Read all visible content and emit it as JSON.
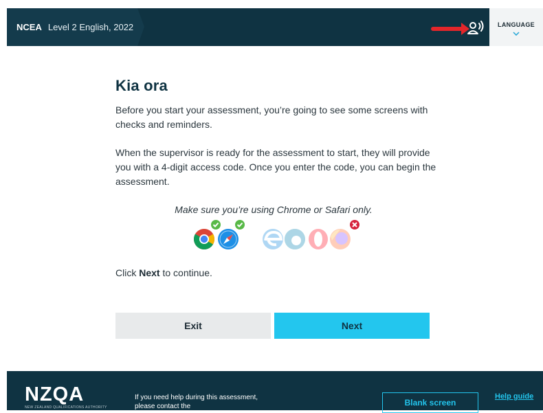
{
  "header": {
    "brand": "NCEA",
    "subject": "Level 2 English, 2022",
    "language_label": "LANGUAGE"
  },
  "main": {
    "title": "Kia ora",
    "paragraph1": "Before you start your assessment, you’re going to see some screens with checks and reminders.",
    "paragraph2": "When the supervisor is ready for the assessment to start, they will provide you with a 4-digit access code. Once you enter the code, you can begin the assessment.",
    "browser_note": "Make sure you’re using Chrome or Safari only.",
    "click_prefix": "Click ",
    "click_bold": "Next",
    "click_suffix": " to continue."
  },
  "buttons": {
    "exit": "Exit",
    "next": "Next"
  },
  "footer": {
    "logo": "NZQA",
    "logo_sub": "NEW ZEALAND QUALIFICATIONS AUTHORITY",
    "help_text": "If you need help during this assessment, please contact the",
    "blank_screen": "Blank screen",
    "help_guide": "Help guide"
  },
  "icons": {
    "audio": "audio-person-icon",
    "language_chevron": "chevron-down-icon",
    "allowed_browsers": [
      "chrome-icon",
      "safari-icon"
    ],
    "disallowed_browsers": [
      "edge-legacy-icon",
      "edge-icon",
      "opera-icon",
      "firefox-icon"
    ],
    "allowed_badge": "check-badge-icon",
    "disallowed_badge": "cross-badge-icon"
  },
  "colors": {
    "header_bg": "#0f3342",
    "accent": "#23c6ee",
    "arrow": "#e3262a",
    "check": "#58b947",
    "cross": "#d6233d"
  }
}
